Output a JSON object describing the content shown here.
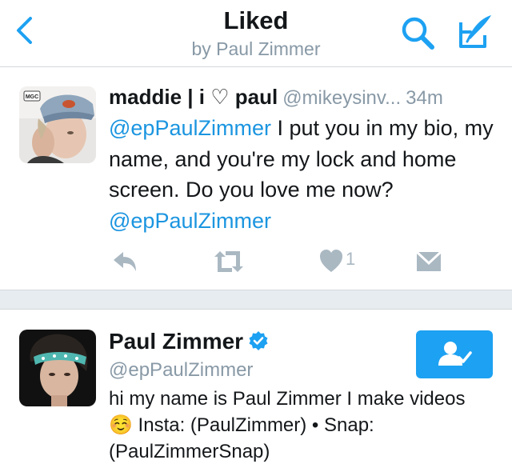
{
  "nav": {
    "title": "Liked",
    "subtitle": "by Paul Zimmer",
    "icons": [
      "chevron-left-icon",
      "search-icon",
      "compose-icon"
    ],
    "accent_color": "#1da1f2"
  },
  "tweet": {
    "name": "maddie | i ♡ paul",
    "handle": "@mikeysinv...",
    "time": "34m",
    "body": {
      "mention1": "@epPaulZimmer",
      "text": " I put you in my bio, my name, and you're my lock and home screen. Do you love me now? ",
      "mention2": "@epPaulZimmer"
    },
    "avatar_sticker": "MGC",
    "like_count": "1",
    "actions": [
      "reply-icon",
      "retweet-icon",
      "heart-icon",
      "direct-message-icon"
    ]
  },
  "user": {
    "name": "Paul Zimmer",
    "handle": "@epPaulZimmer",
    "bio_part1": "hi my name is Paul Zimmer I make videos ",
    "bio_emoji": "☺️",
    "bio_part2": " Insta: (PaulZimmer) • Snap: (PaulZimmerSnap)",
    "verified": true,
    "follow_state": "following"
  }
}
